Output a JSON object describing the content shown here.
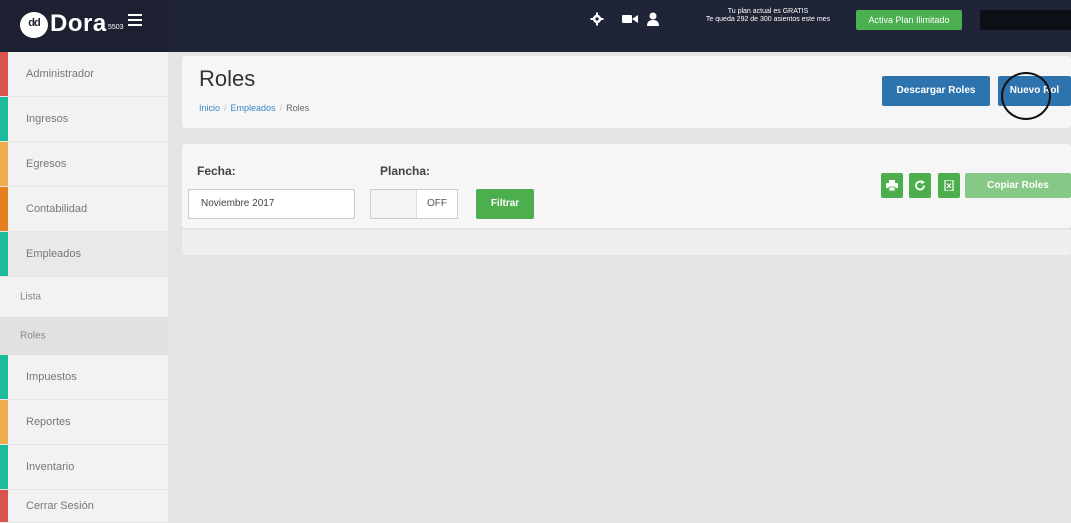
{
  "navbar": {
    "brand_logo": "dd",
    "brand_name": "Dora",
    "brand_sub": "5503",
    "plan_line1": "Tu plan actual es GRATIS",
    "plan_line2": "Te queda 292 de 300 asientos este mes",
    "plan_button": "Activa Plan Ilimitado"
  },
  "sidebar": {
    "items": [
      {
        "label": "Administrador",
        "color": "#d9534f"
      },
      {
        "label": "Ingresos",
        "color": "#1abc9c"
      },
      {
        "label": "Egresos",
        "color": "#f0ad4e"
      },
      {
        "label": "Contabilidad",
        "color": "#e67e22"
      },
      {
        "label": "Empleados",
        "color": "#1abc9c"
      },
      {
        "label": "Impuestos",
        "color": "#1abc9c"
      },
      {
        "label": "Reportes",
        "color": "#f0ad4e"
      },
      {
        "label": "Inventario",
        "color": "#1abc9c"
      },
      {
        "label": "Cerrar Sesión",
        "color": "#d9534f"
      }
    ],
    "subitems": [
      {
        "label": "Lista"
      },
      {
        "label": "Roles"
      }
    ]
  },
  "header": {
    "title": "Roles",
    "breadcrumb": [
      "Inicio",
      "Empleados",
      "Roles"
    ],
    "download_button": "Descargar Roles",
    "new_button": "Nuevo Rol"
  },
  "filters": {
    "fecha_label": "Fecha:",
    "fecha_value": "Noviembre 2017",
    "plancha_label": "Plancha:",
    "plancha_state": "OFF",
    "filter_button": "Filtrar",
    "copy_button": "Copiar Roles"
  },
  "colors": {
    "navbar": "#1f2536",
    "primary": "#2d73ad",
    "success": "#4cae4c"
  }
}
